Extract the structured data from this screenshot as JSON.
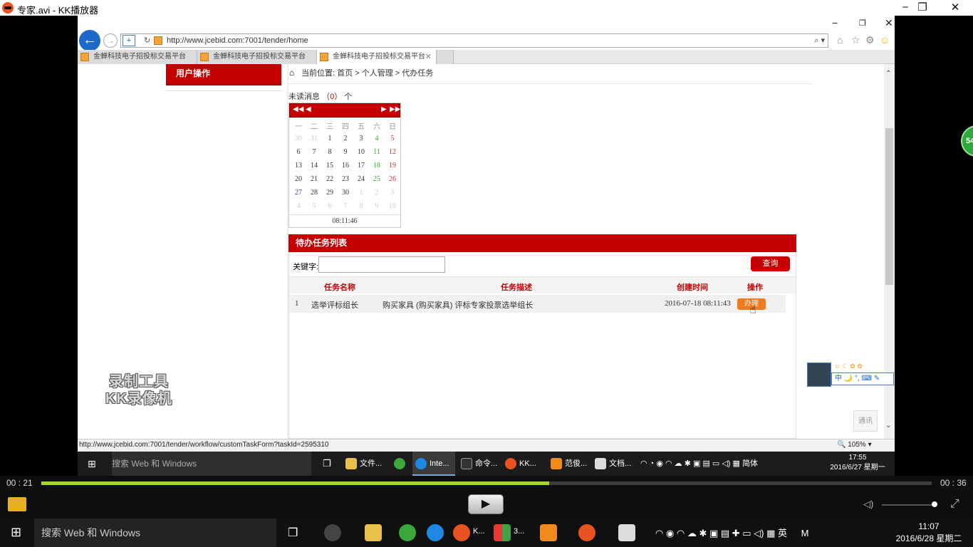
{
  "player": {
    "title": "专家.avi - KK播放器",
    "elapsed": "00 : 21",
    "total": "00 : 36",
    "progress_fraction": 0.57,
    "volume_fraction": 0.95,
    "watermark_line1": "录制工具",
    "watermark_line2": "KK录像机",
    "accent": "#a5d62a"
  },
  "browser": {
    "url": "http://www.jcebid.com:7001/tender/home",
    "tabs": [
      {
        "label": "金蝉科技电子招投标交易平台"
      },
      {
        "label": "金蝉科技电子招投标交易平台"
      },
      {
        "label": "金蝉科技电子招投标交易平台"
      }
    ],
    "status_url": "http://www.jcebid.com:7001/tender/workflow/customTaskForm?taskId=2595310",
    "zoom": "105%"
  },
  "page": {
    "left_panel_title": "用户操作",
    "breadcrumb": "当前位置: 首页 > 个人管理 > 代办任务",
    "unread_prefix": "未读消息 （",
    "unread_count": "0",
    "unread_suffix": "） 个",
    "calendar": {
      "weekdays": [
        "一",
        "二",
        "三",
        "四",
        "五",
        "六",
        "日"
      ],
      "weeks": [
        [
          "30",
          "31",
          "1",
          "2",
          "3",
          "4",
          "5"
        ],
        [
          "6",
          "7",
          "8",
          "9",
          "10",
          "11",
          "12"
        ],
        [
          "13",
          "14",
          "15",
          "16",
          "17",
          "18",
          "19"
        ],
        [
          "20",
          "21",
          "22",
          "23",
          "24",
          "25",
          "26"
        ],
        [
          "27",
          "28",
          "29",
          "30",
          "1",
          "2",
          "3"
        ],
        [
          "4",
          "5",
          "6",
          "7",
          "8",
          "9",
          "10"
        ]
      ],
      "time": "08:11:46"
    },
    "task_list_title": "待办任务列表",
    "keyword_label": "关键字:",
    "keyword_value": "",
    "query_button": "查询",
    "columns": [
      "任务名称",
      "任务描述",
      "创建时间",
      "操作"
    ],
    "rows": [
      {
        "index": "1",
        "name": "选举评标组长",
        "desc": "购买家具 (购买家具) 评标专家投票选举组长",
        "created": "2016-07-18 08:11:43",
        "action": "办理"
      }
    ],
    "notice_button": "通讯",
    "brand_color": "#c50000"
  },
  "inner_taskbar": {
    "search": "搜索 Web 和 Windows",
    "apps": [
      {
        "label": "文件..."
      },
      {
        "label": "Inte..."
      },
      {
        "label": "命令..."
      },
      {
        "label": "KK..."
      },
      {
        "label": "范俊..."
      },
      {
        "label": "文档..."
      }
    ],
    "tray_lang": "简体",
    "time": "17:55",
    "date": "2016/6/27 星期一"
  },
  "host_taskbar": {
    "search": "搜索 Web 和 Windows",
    "app_labels": [
      "K...",
      "3..."
    ],
    "tray_lang": "英",
    "time": "11:07",
    "date": "2016/6/28 星期二"
  },
  "side_badge": "54",
  "ime_bar": "中 🌙 °, ⌨ ✎"
}
